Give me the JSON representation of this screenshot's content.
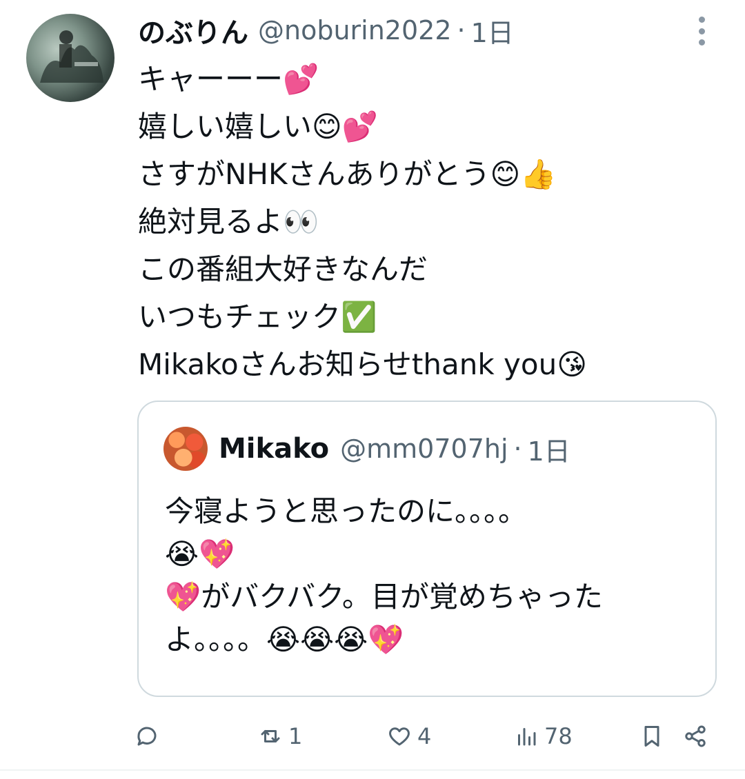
{
  "tweet": {
    "display_name": "のぶりん",
    "handle": "@noburin2022",
    "separator": "·",
    "time": "1日",
    "avatar_icon": "user-avatar",
    "more_icon": "more-vertical-icon",
    "lines": [
      "キャーーー💕",
      "嬉しい嬉しい😊💕",
      "さすがNHKさんありがとう😊👍",
      "絶対見るよ👀",
      "この番組大好きなんだ",
      "いつもチェック✅",
      "Mikakoさんお知らせthank you😘"
    ]
  },
  "quote": {
    "display_name": "Mikako",
    "handle": "@mm0707hj",
    "separator": "·",
    "time": "1日",
    "lines": [
      "今寝ようと思ったのに。。。。",
      "😭💖",
      "💖がバクバク。目が覚めちゃった",
      "よ。。。。😭😭😭💖"
    ]
  },
  "actions": {
    "reply": {
      "icon": "reply-icon",
      "count": ""
    },
    "repost": {
      "icon": "repost-icon",
      "count": "1"
    },
    "like": {
      "icon": "heart-icon",
      "count": "4"
    },
    "views": {
      "icon": "views-icon",
      "count": "78"
    },
    "bookmark": {
      "icon": "bookmark-icon"
    },
    "share": {
      "icon": "share-icon"
    }
  },
  "colors": {
    "text": "#0f1419",
    "secondary": "#536471",
    "border": "#cfd9de"
  }
}
